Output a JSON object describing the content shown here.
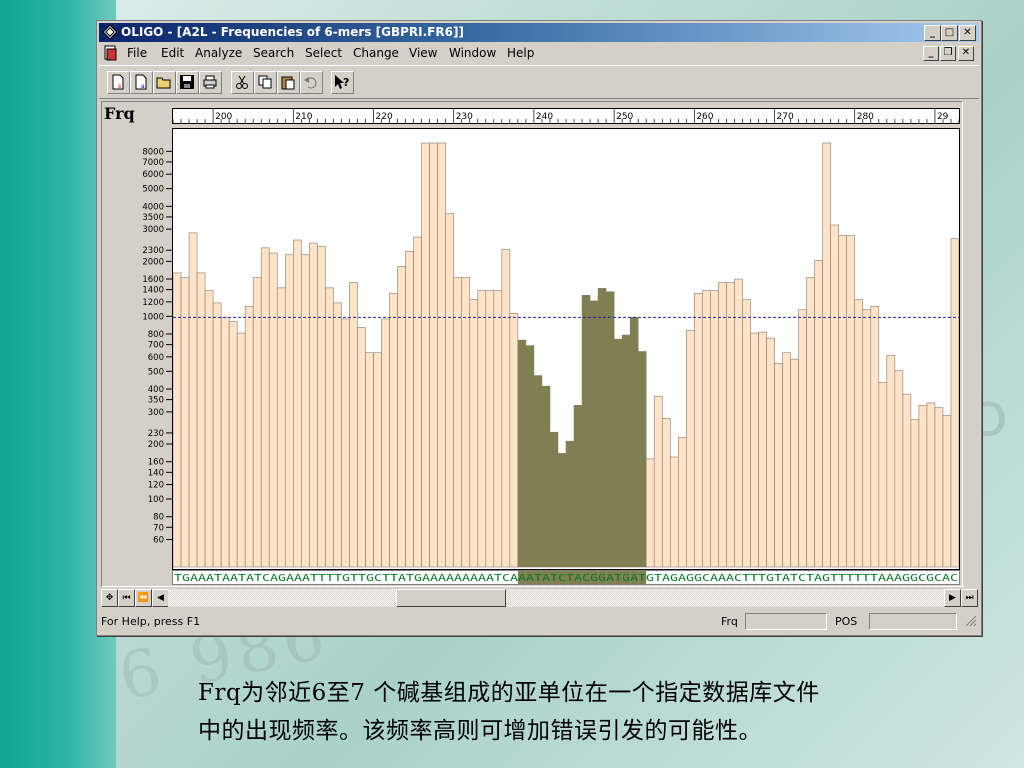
{
  "window": {
    "title": "OLIGO - [A2L - Frequencies of 6-mers [GBPRI.FR6]]"
  },
  "menu": {
    "items": [
      "File",
      "Edit",
      "Analyze",
      "Search",
      "Select",
      "Change",
      "View",
      "Window",
      "Help"
    ]
  },
  "toolbar": {
    "buttons": [
      "new-sense-icon",
      "new-antisense-icon",
      "open-icon",
      "save-icon",
      "print-icon",
      "cut-icon",
      "copy-icon",
      "paste-icon",
      "undo-icon",
      "context-help-icon"
    ]
  },
  "chart": {
    "frq_label": "Frq",
    "ruler_ticks": [
      "200",
      "210",
      "220",
      "230",
      "240",
      "250",
      "260",
      "270",
      "280",
      "29"
    ],
    "y_ticks": [
      "8000",
      "7000",
      "6000",
      "5000",
      "4000",
      "3500",
      "3000",
      "2300",
      "2000",
      "1600",
      "1400",
      "1200",
      "1000",
      "800",
      "700",
      "600",
      "500",
      "400",
      "350",
      "300",
      "230",
      "200",
      "160",
      "140",
      "120",
      "100",
      "80",
      "70",
      "60"
    ],
    "sequence": "TGAAATAATATCAGAAATTTTGTTGCTTATGAAAAAAAAATCAAATATCTACGGATGATGTAGAGGCAAACTTTGTATCTAGTTTTTTAAAGGCGCAC"
  },
  "chart_data": {
    "type": "bar",
    "yscale": "log",
    "ylim": [
      50,
      9000
    ],
    "x_start": 195,
    "threshold": 1000,
    "highlight_range": [
      238,
      253
    ],
    "colors": {
      "bar": "#fde3c8",
      "bar_edge": "#8a7a6a",
      "highlight": "#7f7f50",
      "threshold": "#2222aa"
    },
    "values": [
      1750,
      1650,
      2900,
      1750,
      1400,
      1200,
      1000,
      950,
      820,
      1150,
      1650,
      2400,
      2250,
      1450,
      2200,
      2650,
      2200,
      2550,
      2450,
      1450,
      1200,
      980,
      1550,
      880,
      640,
      640,
      980,
      1350,
      1900,
      2300,
      2750,
      9000,
      9000,
      9000,
      3700,
      1650,
      1650,
      1250,
      1400,
      1400,
      1400,
      2350,
      1050,
      750,
      700,
      480,
      420,
      235,
      180,
      210,
      330,
      1320,
      1230,
      1440,
      1380,
      760,
      800,
      1000,
      650,
      168,
      370,
      280,
      172,
      220,
      850,
      1350,
      1400,
      1400,
      1550,
      1550,
      1620,
      1250,
      820,
      830,
      770,
      560,
      640,
      590,
      1100,
      1650,
      2050,
      9000,
      3200,
      2800,
      2800,
      1250,
      1100,
      1150,
      440,
      620,
      510,
      380,
      275,
      330,
      340,
      320,
      290,
      2700
    ]
  },
  "hscroll": {
    "buttons": [
      "zoom-icon",
      "first-icon",
      "prev-page-icon",
      "left-arrow-icon",
      "right-arrow-icon",
      "last-icon"
    ]
  },
  "status": {
    "help": "For Help, press F1",
    "frq_label": "Frq",
    "pos_label": "POS"
  },
  "caption": {
    "line1": "Frq为邻近6至7 个碱基组成的亚单位在一个指定数据库文件",
    "line2": "中的出现频率。该频率高则可增加错误引发的可能性。"
  },
  "background": {
    "digits": "6 986"
  }
}
